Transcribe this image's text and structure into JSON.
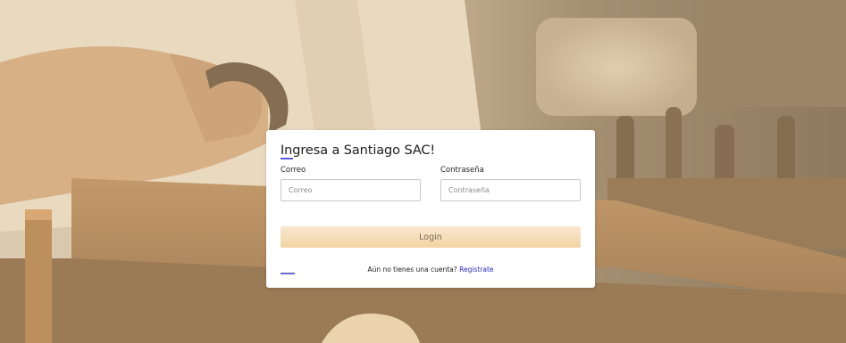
{
  "login": {
    "title": "Ingresa a Santiago SAC!",
    "email_label": "Correo",
    "email_placeholder": "Correo",
    "email_value": "",
    "password_label": "Contraseña",
    "password_placeholder": "Contraseña",
    "password_value": "",
    "submit_label": "Login",
    "register_prompt": "Aún no tienes una cuenta?",
    "register_link": "Registrate"
  },
  "colors": {
    "accent": "#5b5bd6",
    "button_gradient_top": "#f8e8cf",
    "button_gradient_bottom": "#f2d4a4",
    "link": "#2b2bb8"
  }
}
